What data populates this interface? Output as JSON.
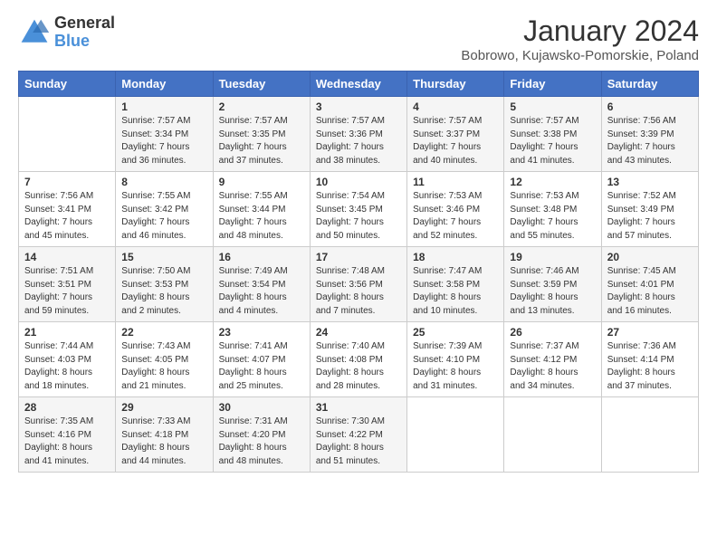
{
  "header": {
    "logo_general": "General",
    "logo_blue": "Blue",
    "month_title": "January 2024",
    "location": "Bobrowo, Kujawsko-Pomorskie, Poland"
  },
  "days_of_week": [
    "Sunday",
    "Monday",
    "Tuesday",
    "Wednesday",
    "Thursday",
    "Friday",
    "Saturday"
  ],
  "weeks": [
    [
      {
        "day": "",
        "info": ""
      },
      {
        "day": "1",
        "info": "Sunrise: 7:57 AM\nSunset: 3:34 PM\nDaylight: 7 hours\nand 36 minutes."
      },
      {
        "day": "2",
        "info": "Sunrise: 7:57 AM\nSunset: 3:35 PM\nDaylight: 7 hours\nand 37 minutes."
      },
      {
        "day": "3",
        "info": "Sunrise: 7:57 AM\nSunset: 3:36 PM\nDaylight: 7 hours\nand 38 minutes."
      },
      {
        "day": "4",
        "info": "Sunrise: 7:57 AM\nSunset: 3:37 PM\nDaylight: 7 hours\nand 40 minutes."
      },
      {
        "day": "5",
        "info": "Sunrise: 7:57 AM\nSunset: 3:38 PM\nDaylight: 7 hours\nand 41 minutes."
      },
      {
        "day": "6",
        "info": "Sunrise: 7:56 AM\nSunset: 3:39 PM\nDaylight: 7 hours\nand 43 minutes."
      }
    ],
    [
      {
        "day": "7",
        "info": "Sunrise: 7:56 AM\nSunset: 3:41 PM\nDaylight: 7 hours\nand 45 minutes."
      },
      {
        "day": "8",
        "info": "Sunrise: 7:55 AM\nSunset: 3:42 PM\nDaylight: 7 hours\nand 46 minutes."
      },
      {
        "day": "9",
        "info": "Sunrise: 7:55 AM\nSunset: 3:44 PM\nDaylight: 7 hours\nand 48 minutes."
      },
      {
        "day": "10",
        "info": "Sunrise: 7:54 AM\nSunset: 3:45 PM\nDaylight: 7 hours\nand 50 minutes."
      },
      {
        "day": "11",
        "info": "Sunrise: 7:53 AM\nSunset: 3:46 PM\nDaylight: 7 hours\nand 52 minutes."
      },
      {
        "day": "12",
        "info": "Sunrise: 7:53 AM\nSunset: 3:48 PM\nDaylight: 7 hours\nand 55 minutes."
      },
      {
        "day": "13",
        "info": "Sunrise: 7:52 AM\nSunset: 3:49 PM\nDaylight: 7 hours\nand 57 minutes."
      }
    ],
    [
      {
        "day": "14",
        "info": "Sunrise: 7:51 AM\nSunset: 3:51 PM\nDaylight: 7 hours\nand 59 minutes."
      },
      {
        "day": "15",
        "info": "Sunrise: 7:50 AM\nSunset: 3:53 PM\nDaylight: 8 hours\nand 2 minutes."
      },
      {
        "day": "16",
        "info": "Sunrise: 7:49 AM\nSunset: 3:54 PM\nDaylight: 8 hours\nand 4 minutes."
      },
      {
        "day": "17",
        "info": "Sunrise: 7:48 AM\nSunset: 3:56 PM\nDaylight: 8 hours\nand 7 minutes."
      },
      {
        "day": "18",
        "info": "Sunrise: 7:47 AM\nSunset: 3:58 PM\nDaylight: 8 hours\nand 10 minutes."
      },
      {
        "day": "19",
        "info": "Sunrise: 7:46 AM\nSunset: 3:59 PM\nDaylight: 8 hours\nand 13 minutes."
      },
      {
        "day": "20",
        "info": "Sunrise: 7:45 AM\nSunset: 4:01 PM\nDaylight: 8 hours\nand 16 minutes."
      }
    ],
    [
      {
        "day": "21",
        "info": "Sunrise: 7:44 AM\nSunset: 4:03 PM\nDaylight: 8 hours\nand 18 minutes."
      },
      {
        "day": "22",
        "info": "Sunrise: 7:43 AM\nSunset: 4:05 PM\nDaylight: 8 hours\nand 21 minutes."
      },
      {
        "day": "23",
        "info": "Sunrise: 7:41 AM\nSunset: 4:07 PM\nDaylight: 8 hours\nand 25 minutes."
      },
      {
        "day": "24",
        "info": "Sunrise: 7:40 AM\nSunset: 4:08 PM\nDaylight: 8 hours\nand 28 minutes."
      },
      {
        "day": "25",
        "info": "Sunrise: 7:39 AM\nSunset: 4:10 PM\nDaylight: 8 hours\nand 31 minutes."
      },
      {
        "day": "26",
        "info": "Sunrise: 7:37 AM\nSunset: 4:12 PM\nDaylight: 8 hours\nand 34 minutes."
      },
      {
        "day": "27",
        "info": "Sunrise: 7:36 AM\nSunset: 4:14 PM\nDaylight: 8 hours\nand 37 minutes."
      }
    ],
    [
      {
        "day": "28",
        "info": "Sunrise: 7:35 AM\nSunset: 4:16 PM\nDaylight: 8 hours\nand 41 minutes."
      },
      {
        "day": "29",
        "info": "Sunrise: 7:33 AM\nSunset: 4:18 PM\nDaylight: 8 hours\nand 44 minutes."
      },
      {
        "day": "30",
        "info": "Sunrise: 7:31 AM\nSunset: 4:20 PM\nDaylight: 8 hours\nand 48 minutes."
      },
      {
        "day": "31",
        "info": "Sunrise: 7:30 AM\nSunset: 4:22 PM\nDaylight: 8 hours\nand 51 minutes."
      },
      {
        "day": "",
        "info": ""
      },
      {
        "day": "",
        "info": ""
      },
      {
        "day": "",
        "info": ""
      }
    ]
  ]
}
